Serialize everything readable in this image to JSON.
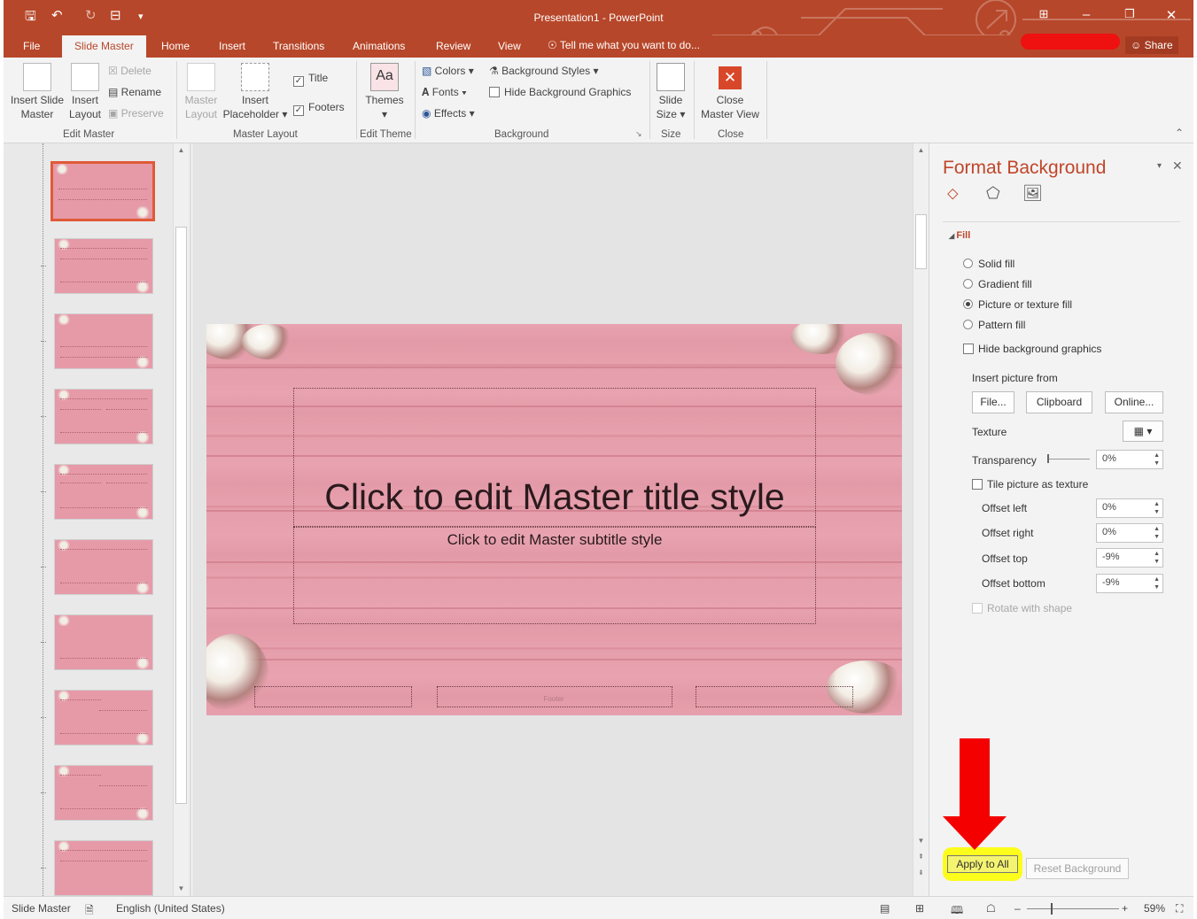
{
  "window": {
    "title": "Presentation1 - PowerPoint",
    "share_label": "Share"
  },
  "quick_access": [
    "save-icon",
    "undo-icon",
    "redo-icon",
    "start-from-beginning-icon"
  ],
  "tabs": [
    "File",
    "Slide Master",
    "Home",
    "Insert",
    "Transitions",
    "Animations",
    "Review",
    "View"
  ],
  "active_tab": "Slide Master",
  "tell_me": "Tell me what you want to do...",
  "ribbon": {
    "insert_slide_master": [
      "Insert Slide",
      "Master"
    ],
    "insert_layout": [
      "Insert",
      "Layout"
    ],
    "delete": "Delete",
    "rename": "Rename",
    "preserve": "Preserve",
    "master_layout_btn": [
      "Master",
      "Layout"
    ],
    "insert_placeholder": [
      "Insert",
      "Placeholder"
    ],
    "title_chk": "Title",
    "footers_chk": "Footers",
    "themes": "Themes",
    "colors": "Colors",
    "fonts": "Fonts",
    "effects": "Effects",
    "background_styles": "Background Styles",
    "hide_bg_graphics": "Hide Background Graphics",
    "slide_size": [
      "Slide",
      "Size"
    ],
    "close_master_view": [
      "Close",
      "Master View"
    ],
    "groups": {
      "edit_master": "Edit Master",
      "master_layout": "Master Layout",
      "edit_theme": "Edit Theme",
      "background": "Background",
      "size": "Size",
      "close": "Close"
    }
  },
  "slide": {
    "title": "Click to edit Master title style",
    "subtitle": "Click to edit Master subtitle style",
    "footer": "Footer"
  },
  "pane": {
    "title": "Format Background",
    "section": "Fill",
    "fill_options": [
      "Solid fill",
      "Gradient fill",
      "Picture or texture fill",
      "Pattern fill"
    ],
    "selected_fill": "Picture or texture fill",
    "hide_graphics": "Hide background graphics",
    "insert_from": "Insert picture from",
    "buttons": [
      "File...",
      "Clipboard",
      "Online..."
    ],
    "texture": "Texture",
    "transparency": "Transparency",
    "transparency_value": "0%",
    "tile": "Tile picture as texture",
    "offsets": [
      {
        "label": "Offset left",
        "value": "0%"
      },
      {
        "label": "Offset right",
        "value": "0%"
      },
      {
        "label": "Offset top",
        "value": "-9%"
      },
      {
        "label": "Offset bottom",
        "value": "-9%"
      }
    ],
    "rotate": "Rotate with shape",
    "apply_all": "Apply to All",
    "reset": "Reset Background"
  },
  "status": {
    "view": "Slide Master",
    "language": "English (United States)",
    "zoom": "59%"
  },
  "colors": {
    "accent": "#b7472a",
    "highlight": "#fdfd1c",
    "arrow": "#f40000"
  }
}
